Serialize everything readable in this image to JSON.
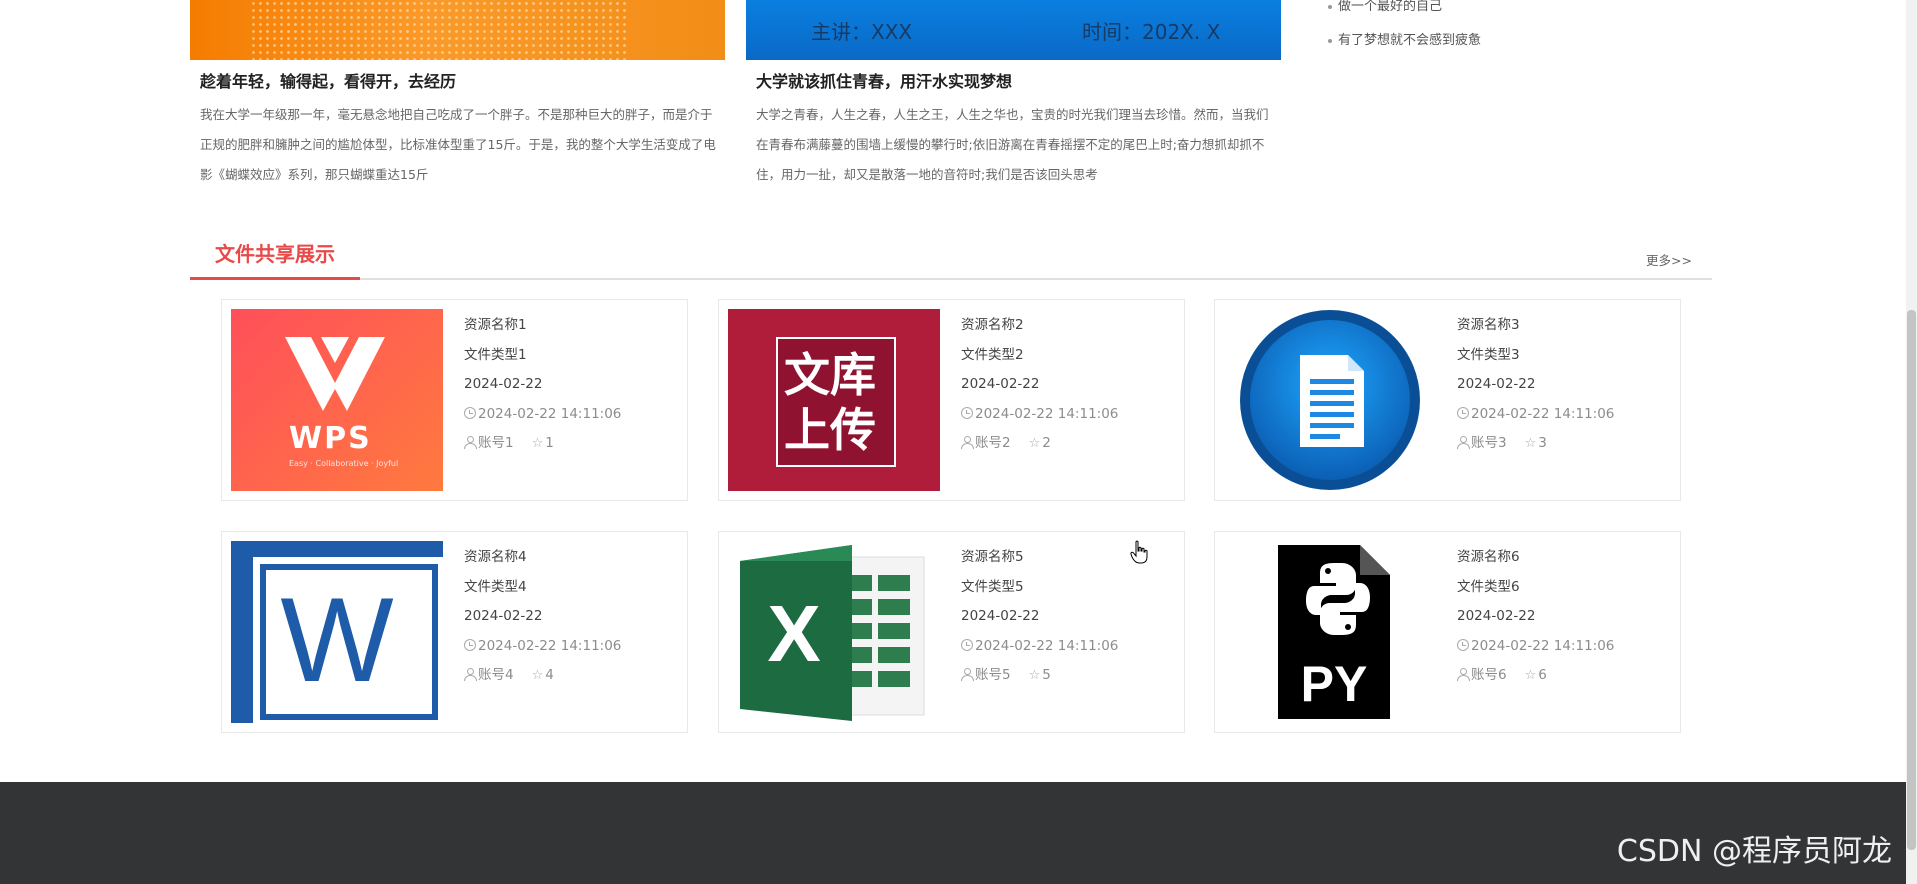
{
  "top_articles": {
    "left": {
      "title": "趁着年轻，输得起，看得开，去经历",
      "excerpt": "我在大学一年级那一年，毫无悬念地把自己吃成了一个胖子。不是那种巨大的胖子，而是介于正规的肥胖和臃肿之间的尴尬体型，比标准体型重了15斤。于是，我的整个大学生活变成了电影《蝴蝶效应》系列，那只蝴蝶重达15斤"
    },
    "right": {
      "banner_speaker": "主讲：XXX",
      "banner_time": "时间：202X. X",
      "title": "大学就该抓住青春，用汗水实现梦想",
      "excerpt": "大学之青春，人生之春，人生之王，人生之华也，宝贵的时光我们理当去珍惜。然而，当我们在青春布满藤蔓的围墙上缓慢的攀行时;依旧游离在青春摇摆不定的尾巴上时;奋力想抓却抓不住，用力一扯，却又是散落一地的音符时;我们是否该回头思考"
    }
  },
  "side_list": [
    "做一个最好的自己",
    "有了梦想就不会感到疲惫"
  ],
  "section": {
    "title": "文件共享展示",
    "more": "更多>>"
  },
  "files": [
    {
      "name": "资源名称1",
      "type": "文件类型1",
      "date": "2024-02-22",
      "time": "2024-02-22 14:11:06",
      "account": "账号1",
      "stars": "1",
      "icon": "wps-icon"
    },
    {
      "name": "资源名称2",
      "type": "文件类型2",
      "date": "2024-02-22",
      "time": "2024-02-22 14:11:06",
      "account": "账号2",
      "stars": "2",
      "icon": "wenku-upload-icon"
    },
    {
      "name": "资源名称3",
      "type": "文件类型3",
      "date": "2024-02-22",
      "time": "2024-02-22 14:11:06",
      "account": "账号3",
      "stars": "3",
      "icon": "document-icon"
    },
    {
      "name": "资源名称4",
      "type": "文件类型4",
      "date": "2024-02-22",
      "time": "2024-02-22 14:11:06",
      "account": "账号4",
      "stars": "4",
      "icon": "word-icon"
    },
    {
      "name": "资源名称5",
      "type": "文件类型5",
      "date": "2024-02-22",
      "time": "2024-02-22 14:11:06",
      "account": "账号5",
      "stars": "5",
      "icon": "excel-icon"
    },
    {
      "name": "资源名称6",
      "type": "文件类型6",
      "date": "2024-02-22",
      "time": "2024-02-22 14:11:06",
      "account": "账号6",
      "stars": "6",
      "icon": "python-file-icon"
    }
  ],
  "wps_thumb": {
    "word": "WPS",
    "tagline": "Easy · Collaborative · Joyful"
  },
  "wenku_thumb": {
    "line1": "文库",
    "line2": "上传"
  },
  "python_thumb": {
    "label": "PY"
  },
  "word_thumb": {
    "letter": "W"
  },
  "excel_thumb": {
    "letter": "X"
  },
  "footer": {
    "watermark": "CSDN @程序员阿龙"
  },
  "colors": {
    "accent": "#e84a4a",
    "footer_bg": "#333436"
  }
}
